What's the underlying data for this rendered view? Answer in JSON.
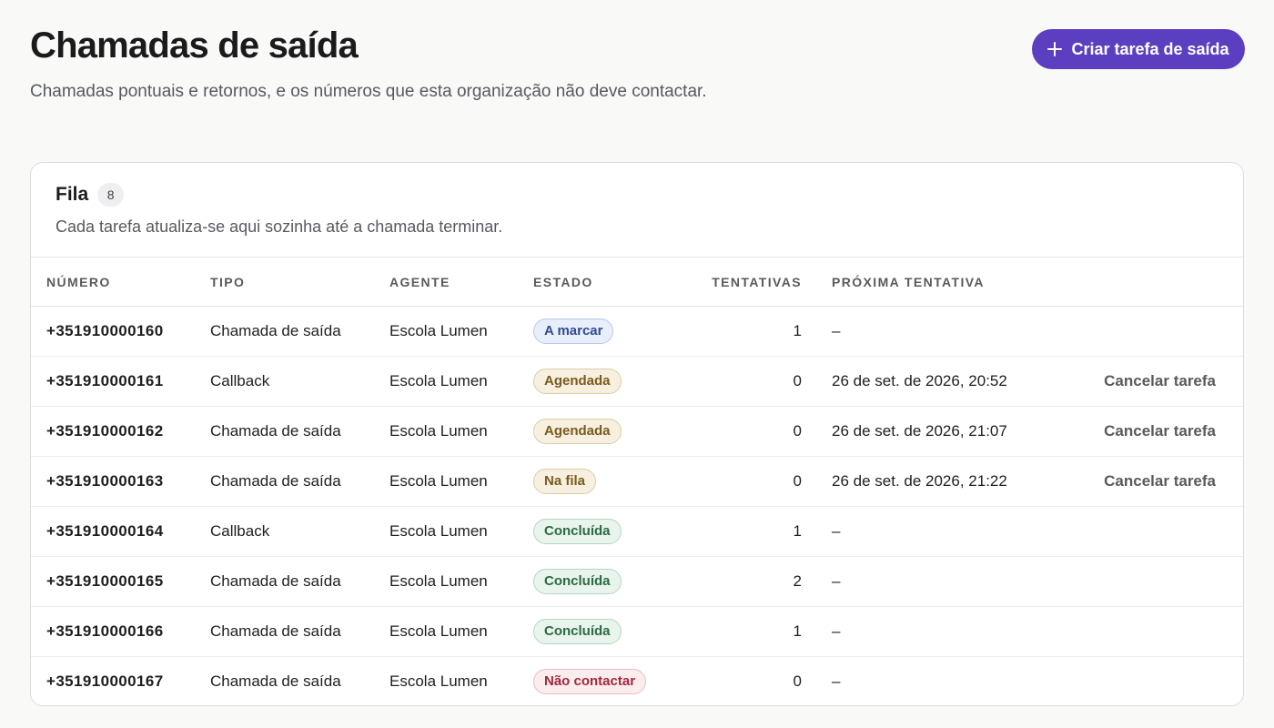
{
  "header": {
    "title": "Chamadas de saída",
    "subtitle": "Chamadas pontuais e retornos, e os números que esta organização não deve contactar.",
    "create_button": "Criar tarefa de saída"
  },
  "queue": {
    "title": "Fila",
    "count": "8",
    "description": "Cada tarefa atualiza-se aqui sozinha até a chamada terminar.",
    "columns": {
      "number": "NÚMERO",
      "type": "TIPO",
      "agent": "AGENTE",
      "status": "ESTADO",
      "attempts": "TENTATIVAS",
      "next_attempt": "PRÓXIMA TENTATIVA"
    },
    "rows": [
      {
        "number": "+351910000160",
        "type": "Chamada de saída",
        "agent": "Escola Lumen",
        "status": "A marcar",
        "status_tone": "blue",
        "attempts": "1",
        "next_attempt": "–",
        "action": ""
      },
      {
        "number": "+351910000161",
        "type": "Callback",
        "agent": "Escola Lumen",
        "status": "Agendada",
        "status_tone": "amber",
        "attempts": "0",
        "next_attempt": "26 de set. de 2026, 20:52",
        "action": "Cancelar tarefa"
      },
      {
        "number": "+351910000162",
        "type": "Chamada de saída",
        "agent": "Escola Lumen",
        "status": "Agendada",
        "status_tone": "amber",
        "attempts": "0",
        "next_attempt": "26 de set. de 2026, 21:07",
        "action": "Cancelar tarefa"
      },
      {
        "number": "+351910000163",
        "type": "Chamada de saída",
        "agent": "Escola Lumen",
        "status": "Na fila",
        "status_tone": "amber",
        "attempts": "0",
        "next_attempt": "26 de set. de 2026, 21:22",
        "action": "Cancelar tarefa"
      },
      {
        "number": "+351910000164",
        "type": "Callback",
        "agent": "Escola Lumen",
        "status": "Concluída",
        "status_tone": "green",
        "attempts": "1",
        "next_attempt": "–",
        "action": ""
      },
      {
        "number": "+351910000165",
        "type": "Chamada de saída",
        "agent": "Escola Lumen",
        "status": "Concluída",
        "status_tone": "green",
        "attempts": "2",
        "next_attempt": "–",
        "action": ""
      },
      {
        "number": "+351910000166",
        "type": "Chamada de saída",
        "agent": "Escola Lumen",
        "status": "Concluída",
        "status_tone": "green",
        "attempts": "1",
        "next_attempt": "–",
        "action": ""
      },
      {
        "number": "+351910000167",
        "type": "Chamada de saída",
        "agent": "Escola Lumen",
        "status": "Não contactar",
        "status_tone": "red",
        "attempts": "0",
        "next_attempt": "–",
        "action": ""
      }
    ]
  },
  "colors": {
    "accent": "#5b3fc0",
    "status_blue": "#2f4c8f",
    "status_amber": "#7a5a1c",
    "status_green": "#2c6a44",
    "status_red": "#a0283d"
  },
  "icons": {
    "create_button": "plus-icon"
  }
}
